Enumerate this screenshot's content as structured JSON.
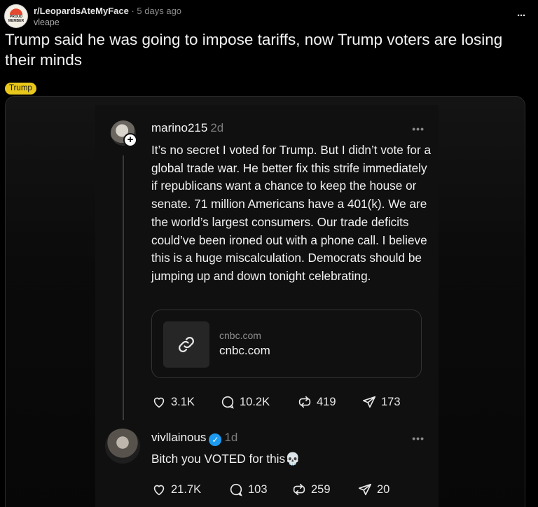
{
  "post": {
    "subreddit": "r/LeopardsAteMyFace",
    "separator": "·",
    "age": "5 days ago",
    "author": "vleape",
    "avatar_text": "PROUD MEMBER",
    "more": "···",
    "title": "Trump said he was going to impose tariffs, now Trump voters are losing their minds",
    "flair": "Trump"
  },
  "thread": {
    "post1": {
      "username": "marino215",
      "age": "2d",
      "more": "•••",
      "body": "It’s no secret I voted for Trump. But I didn’t vote for a global trade war. He better fix this strife immediately if republicans want a chance to keep the house or senate. 71 million Americans have a 401(k). We are the world’s largest consumers. Our trade deficits could’ve been ironed out with a phone call. I believe this is a huge miscalculation. Democrats should be jumping up and down tonight celebrating.",
      "link": {
        "domain_small": "cnbc.com",
        "domain": "cnbc.com"
      },
      "likes": "3.1K",
      "replies": "10.2K",
      "reposts": "419",
      "shares": "173"
    },
    "post2": {
      "username": "vivllainous",
      "age": "1d",
      "more": "•••",
      "body": "Bitch you VOTED for this💀",
      "likes": "21.7K",
      "replies": "103",
      "reposts": "259",
      "shares": "20"
    }
  },
  "icons": [
    "heart-icon",
    "comment-icon",
    "repost-icon",
    "share-icon",
    "link-icon",
    "verified-icon",
    "plus-icon"
  ],
  "colors": {
    "flair": "#e8c81c",
    "verified": "#1d9bf0",
    "background": "#000000"
  }
}
